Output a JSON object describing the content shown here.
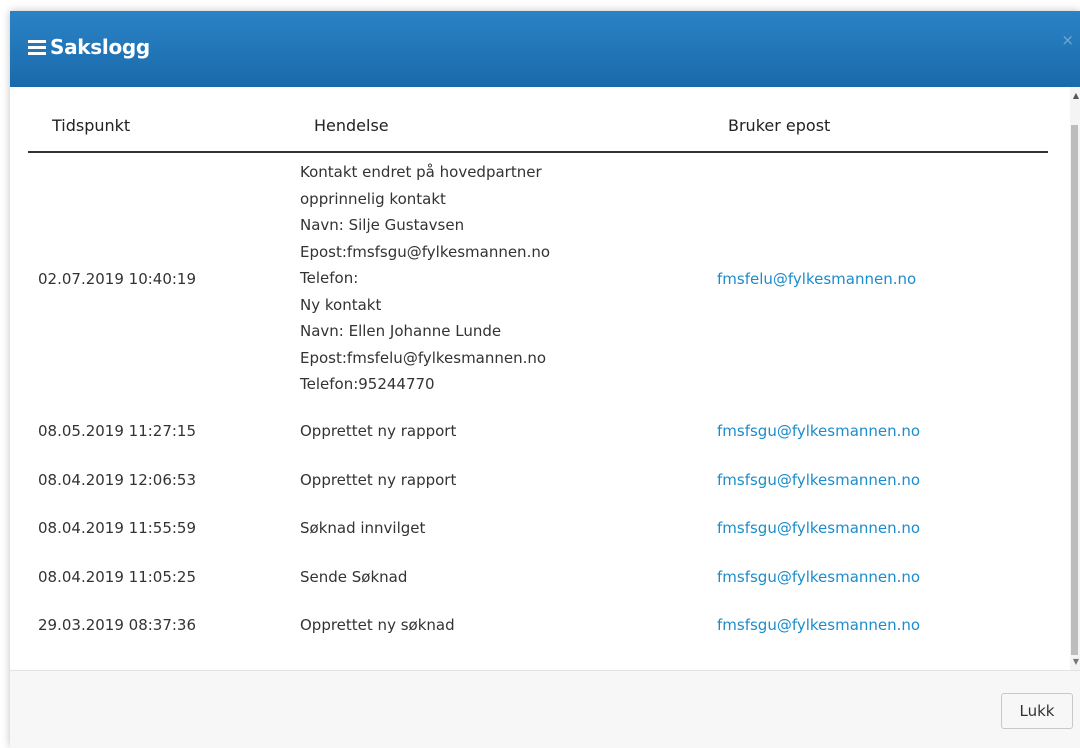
{
  "dialog": {
    "title": "Sakslogg",
    "close_glyph": "×",
    "icon": "list-icon"
  },
  "table": {
    "columns": [
      "Tidspunkt",
      "Hendelse",
      "Bruker epost"
    ],
    "rows": [
      {
        "time": "02.07.2019 10:40:19",
        "event": "Kontakt endret på hovedpartner\nopprinnelig kontakt\nNavn: Silje Gustavsen\nEpost:fmsfsgu@fylkesmannen.no\nTelefon:\nNy kontakt\nNavn: Ellen Johanne Lunde\nEpost:fmsfelu@fylkesmannen.no\nTelefon:95244770",
        "email": "fmsfelu@fylkesmannen.no"
      },
      {
        "time": "08.05.2019 11:27:15",
        "event": "Opprettet ny rapport",
        "email": "fmsfsgu@fylkesmannen.no"
      },
      {
        "time": "08.04.2019 12:06:53",
        "event": "Opprettet ny rapport",
        "email": "fmsfsgu@fylkesmannen.no"
      },
      {
        "time": "08.04.2019 11:55:59",
        "event": "Søknad innvilget",
        "email": "fmsfsgu@fylkesmannen.no"
      },
      {
        "time": "08.04.2019 11:05:25",
        "event": "Sende Søknad",
        "email": "fmsfsgu@fylkesmannen.no"
      },
      {
        "time": "29.03.2019 08:37:36",
        "event": "Opprettet ny søknad",
        "email": "fmsfsgu@fylkesmannen.no"
      }
    ]
  },
  "footer": {
    "close_label": "Lukk"
  },
  "colors": {
    "header": "#1a6aaa",
    "link": "#1c8ccd"
  }
}
